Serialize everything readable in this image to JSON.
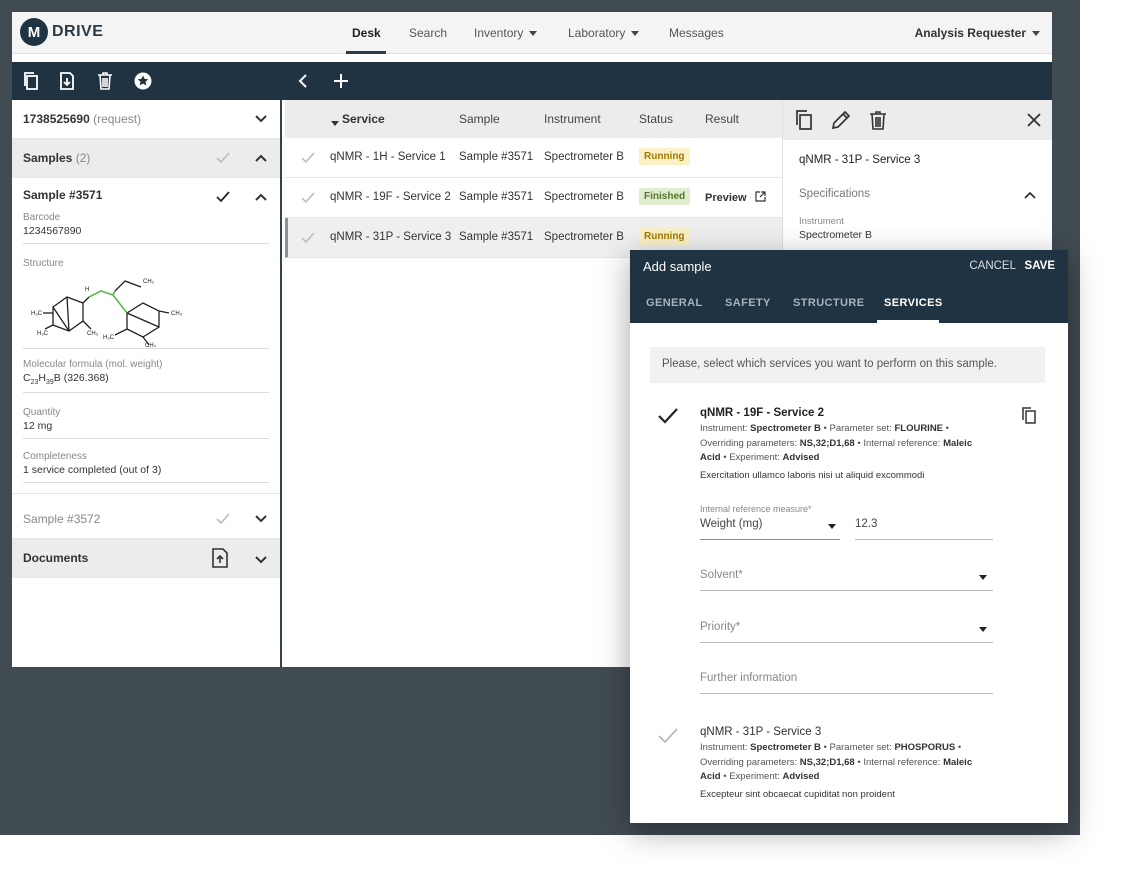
{
  "nav": {
    "logo_mark": "M",
    "logo_text": "DRIVE",
    "items": [
      {
        "label": "Desk"
      },
      {
        "label": "Search"
      },
      {
        "label": "Inventory"
      },
      {
        "label": "Laboratory"
      },
      {
        "label": "Messages"
      }
    ],
    "user": "Analysis Requester"
  },
  "toolbar": {
    "icons": [
      "copy-icon",
      "download-icon",
      "trash-icon",
      "star-badge-icon",
      "back-chevron-icon",
      "plus-icon"
    ]
  },
  "left": {
    "request_id": "1738525690",
    "request_suffix": "(request)",
    "samples_label": "Samples",
    "samples_count": "(2)",
    "sample1": {
      "title": "Sample #3571",
      "barcode_label": "Barcode",
      "barcode": "1234567890",
      "structure_label": "Structure",
      "formula_label": "Molecular formula (mol. weight)",
      "formula_c": "C",
      "formula_c_sub": "23",
      "formula_h": "H",
      "formula_h_sub": "39",
      "formula_rest": "B (326.368)",
      "quantity_label": "Quantity",
      "quantity": "12 mg",
      "completeness_label": "Completeness",
      "completeness": "1 service completed (out of 3)"
    },
    "sample2": {
      "title": "Sample #3572"
    },
    "documents_label": "Documents"
  },
  "table": {
    "headers": [
      "Service",
      "Sample",
      "Instrument",
      "Status",
      "Result"
    ],
    "rows": [
      {
        "service": "qNMR - 1H - Service 1",
        "sample": "Sample #3571",
        "instrument": "Spectrometer B",
        "status": "Running",
        "result": ""
      },
      {
        "service": "qNMR - 19F - Service 2",
        "sample": "Sample #3571",
        "instrument": "Spectrometer B",
        "status": "Finished",
        "result": "Preview"
      },
      {
        "service": "qNMR - 31P - Service 3",
        "sample": "Sample #3571",
        "instrument": "Spectrometer B",
        "status": "Running",
        "result": ""
      }
    ]
  },
  "detail": {
    "title": "qNMR - 31P - Service 3",
    "section": "Specifications",
    "instrument_label": "Instrument",
    "instrument": "Spectrometer B"
  },
  "modal": {
    "title": "Add sample",
    "cancel": "CANCEL",
    "save": "SAVE",
    "tabs": [
      "GENERAL",
      "SAFETY",
      "STRUCTURE",
      "SERVICES"
    ],
    "hint": "Please, select which services you want to perform on this sample.",
    "service2": {
      "title": "qNMR - 19F - Service 2",
      "l1_a": "Instrument: ",
      "l1_b": "Spectrometer B",
      "l1_c": " • Parameter set: ",
      "l1_d": "FLOURINE",
      "l1_e": " •",
      "l2_a": "Overriding parameters: ",
      "l2_b": "NS,32;D1,68",
      "l2_c": " • Internal reference: ",
      "l2_d": "Maleic",
      "l3_a": "Acid",
      "l3_b": " • Experiment: ",
      "l3_c": "Advised",
      "desc": "Exercitation ullamco laboris nisi ut aliquid excommodi"
    },
    "form": {
      "irm_label": "Internal reference measure*",
      "irm_unit": "Weight (mg)",
      "irm_value": "12.3",
      "solvent": "Solvent*",
      "priority": "Priority*",
      "further": "Further information"
    },
    "service3": {
      "title": "qNMR - 31P - Service 3",
      "l1_a": "Instrument: ",
      "l1_b": "Spectrometer B",
      "l1_c": " • Parameter set: ",
      "l1_d": "PHOSPORUS",
      "l1_e": " •",
      "l2_a": "Overriding parameters: ",
      "l2_b": "NS,32;D1,68",
      "l2_c": " • Internal reference: ",
      "l2_d": "Maleic",
      "l3_a": "Acid",
      "l3_b": " • Experiment: ",
      "l3_c": "Advised",
      "desc": "Excepteur sint obcaecat cupiditat non proident"
    }
  }
}
